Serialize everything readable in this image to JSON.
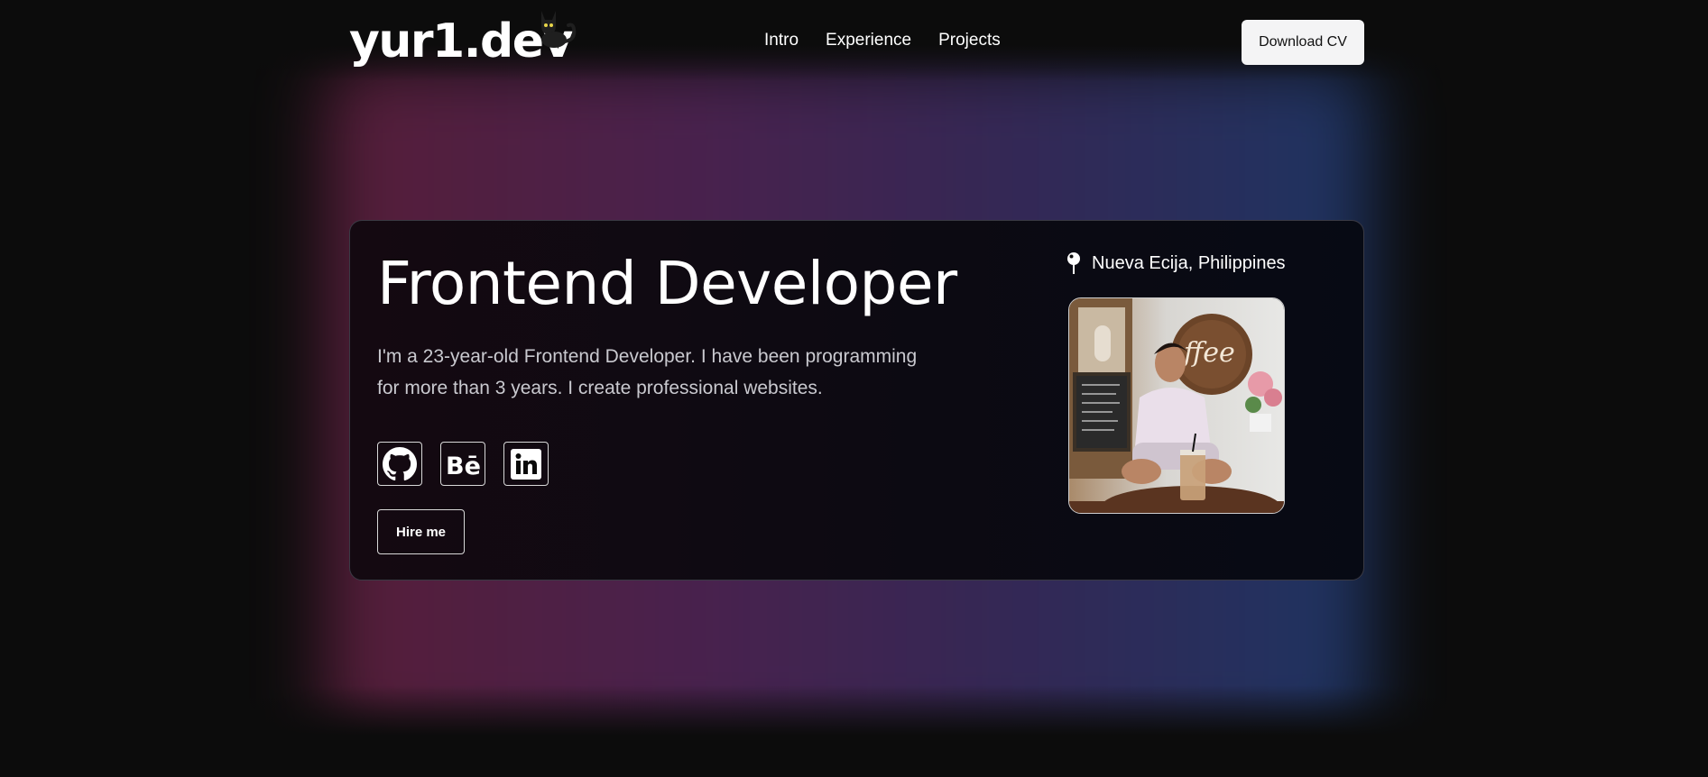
{
  "header": {
    "logo": "yur1.dev",
    "nav": [
      {
        "label": "Intro"
      },
      {
        "label": "Experience"
      },
      {
        "label": "Projects"
      }
    ],
    "cv_button": "Download CV"
  },
  "hero": {
    "title": "Frontend Developer",
    "intro": "I'm a 23-year-old Frontend Developer. I have been programming for more than 3 years. I create professional websites.",
    "socials": [
      {
        "icon": "github-icon"
      },
      {
        "icon": "behance-icon"
      },
      {
        "icon": "linkedin-icon"
      }
    ],
    "hire_button": "Hire me",
    "location": "Nueva Ecija, Philippines",
    "photo_icon": "profile-photo"
  },
  "colors": {
    "background": "#0c0c0c",
    "glow_start": "#6b2345",
    "glow_mid": "#5b2860",
    "glow_end": "#23407a",
    "cv_button_bg": "#f4f4f5"
  }
}
